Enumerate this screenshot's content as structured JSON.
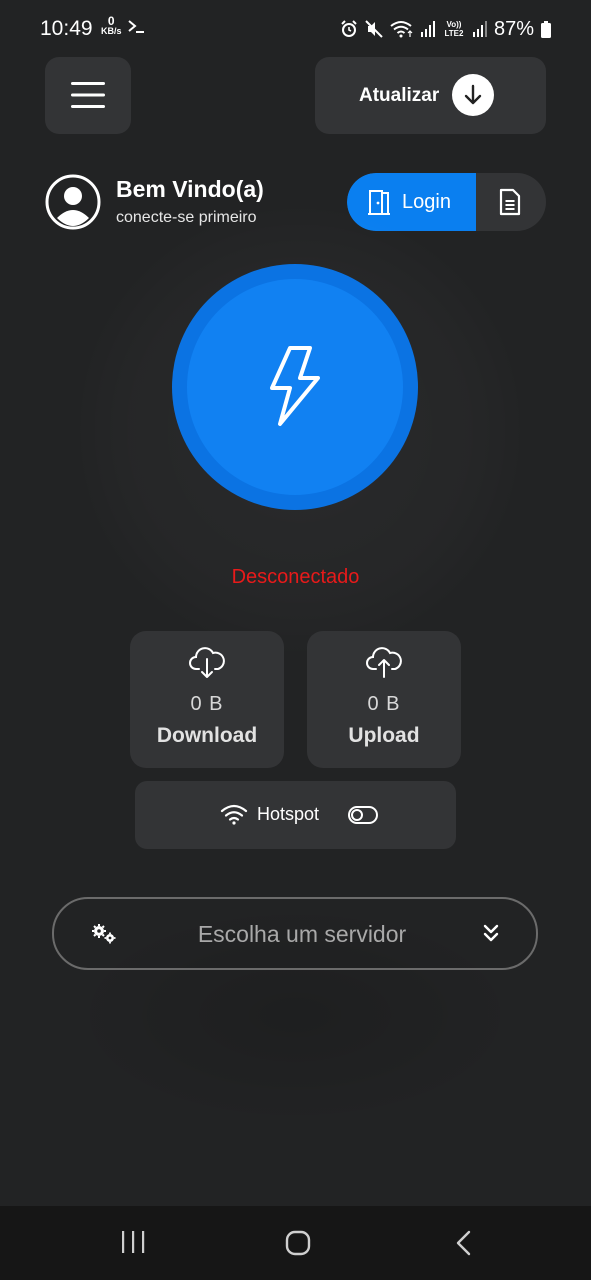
{
  "status_bar": {
    "time": "10:49",
    "net_speed_value": "0",
    "net_speed_unit": "KB/s",
    "network_label": "Vo)) LTE2",
    "battery": "87%"
  },
  "header": {
    "update_label": "Atualizar"
  },
  "user": {
    "welcome": "Bem Vindo(a)",
    "subtitle": "conecte-se primeiro",
    "login_label": "Login"
  },
  "connection": {
    "status": "Desconectado",
    "status_color": "#e81a1a",
    "button_color": "#1181f2"
  },
  "stats": {
    "download": {
      "value": "0 B",
      "label": "Download"
    },
    "upload": {
      "value": "0 B",
      "label": "Upload"
    }
  },
  "hotspot": {
    "label": "Hotspot",
    "enabled": false
  },
  "server": {
    "placeholder": "Escolha um servidor"
  },
  "icons": {
    "menu": "hamburger-icon",
    "update": "download-arrow-icon",
    "avatar": "user-circle-icon",
    "login": "door-icon",
    "document": "document-icon",
    "connect": "lightning-icon",
    "download": "cloud-download-icon",
    "upload": "cloud-upload-icon",
    "hotspot": "wifi-icon",
    "toggle": "toggle-off-icon",
    "server": "gears-icon",
    "dropdown": "double-chevron-down-icon"
  }
}
